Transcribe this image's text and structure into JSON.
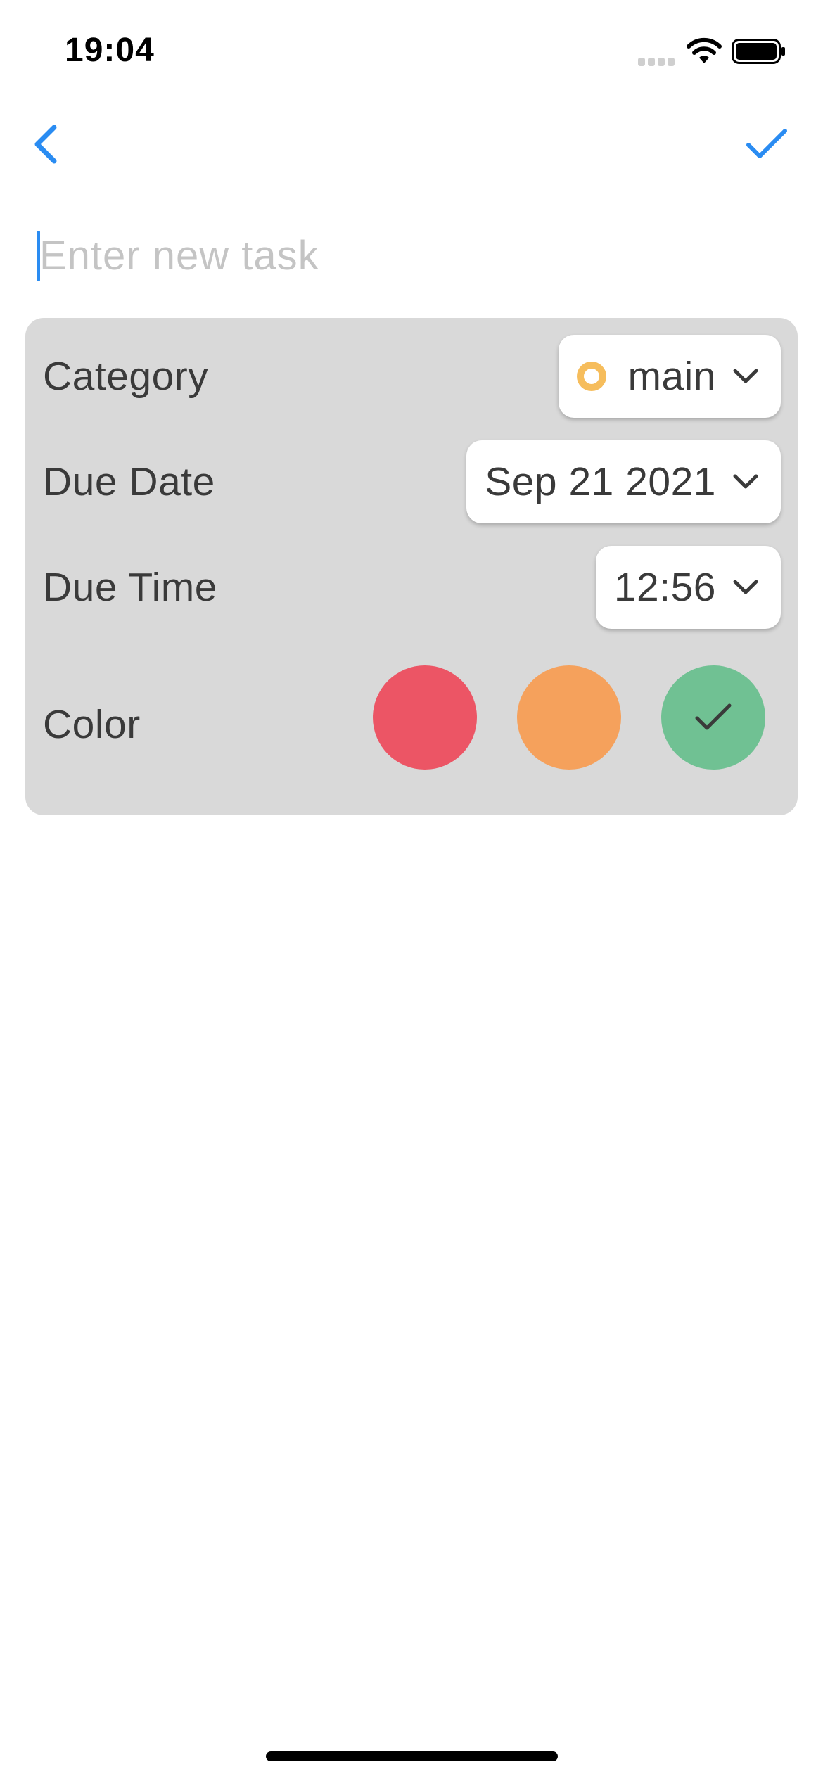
{
  "status_bar": {
    "time": "19:04"
  },
  "nav": {
    "back_icon": "chevron-left-icon",
    "confirm_icon": "checkmark-icon",
    "accent_color": "#2a8cf2"
  },
  "task_input": {
    "value": "",
    "placeholder": "Enter new task"
  },
  "settings": {
    "category": {
      "label": "Category",
      "value": "main",
      "dot_color": "#f6bd5c"
    },
    "due_date": {
      "label": "Due Date",
      "value": "Sep 21 2021"
    },
    "due_time": {
      "label": "Due Time",
      "value": "12:56"
    },
    "color": {
      "label": "Color",
      "options": [
        {
          "name": "red",
          "hex": "#ec5565",
          "selected": false
        },
        {
          "name": "orange",
          "hex": "#f5a15c",
          "selected": false
        },
        {
          "name": "green",
          "hex": "#70c193",
          "selected": true
        }
      ]
    }
  },
  "colors": {
    "card_background": "#d9d9d9",
    "text": "#3a3a3a",
    "placeholder": "#c4c4c4"
  }
}
